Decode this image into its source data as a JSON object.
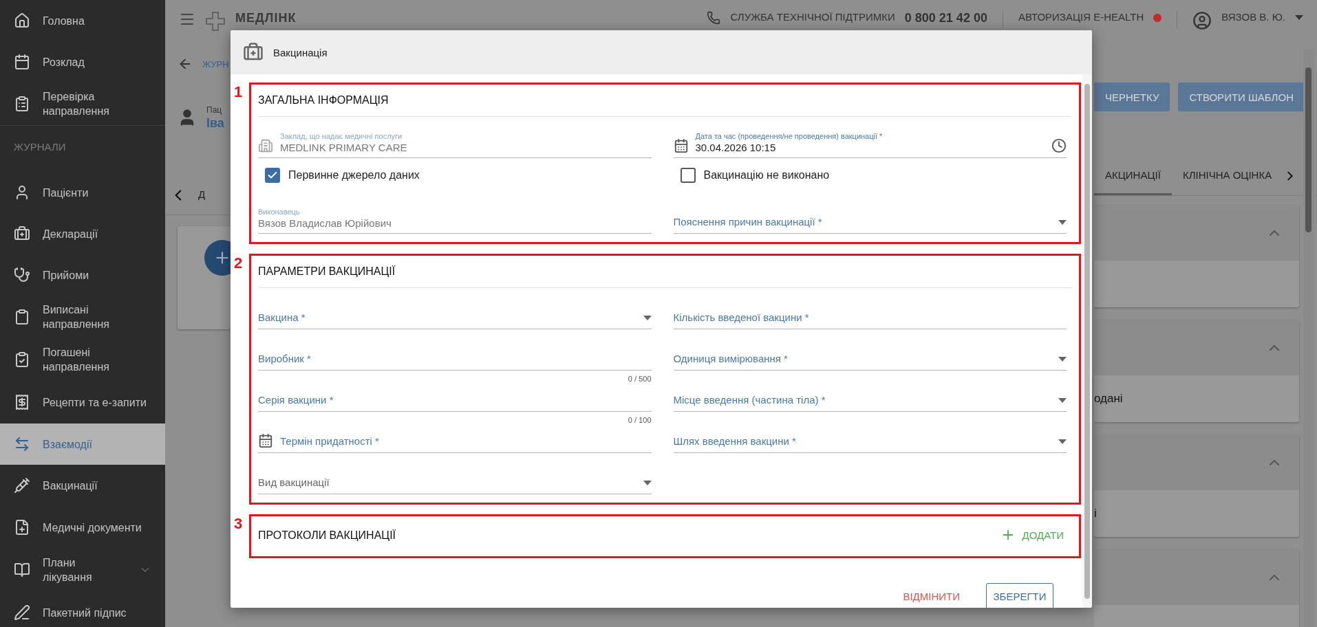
{
  "sidebar": {
    "items": [
      {
        "label": "Головна",
        "selected": false
      },
      {
        "label": "Розклад",
        "selected": false
      },
      {
        "label": "Перевірка направлення",
        "selected": false
      }
    ],
    "section_title": "ЖУРНАЛИ",
    "journal_items": [
      {
        "label": "Пацієнти",
        "selected": false
      },
      {
        "label": "Декларації",
        "selected": false
      },
      {
        "label": "Прийоми",
        "selected": false
      },
      {
        "label": "Виписані направлення",
        "selected": false
      },
      {
        "label": "Погашені направлення",
        "selected": false
      },
      {
        "label": "Рецепти та е-запити",
        "selected": false
      },
      {
        "label": "Взаємодії",
        "selected": true
      },
      {
        "label": "Вакцинації",
        "selected": false
      },
      {
        "label": "Медичні документи",
        "selected": false
      },
      {
        "label": "Плани лікування",
        "selected": false,
        "expanded": false
      },
      {
        "label": "Пакетний підпис",
        "selected": false
      }
    ]
  },
  "top_bar": {
    "logo": "МЕДЛІНК",
    "support_label": "СЛУЖБА ТЕХНІЧНОЇ ПІДТРИМКИ",
    "support_phone": "0 800 21 42 00",
    "ehealth": "АВТОРИЗАЦІЯ E-HEALTH",
    "ehealth_connected": false,
    "user": "ВЯЗОВ В. Ю."
  },
  "background": {
    "back_link": "ЖУРН",
    "patient_label": "Пац",
    "patient_name": "Іва",
    "tab_fragment": "Д",
    "buttons": [
      "ЧЕРНЕТКУ",
      "СТВОРИТИ ШАБЛОН"
    ],
    "tabs": [
      {
        "label": "АКЦИНАЦІЇ",
        "selected": true
      },
      {
        "label": "КЛІНІЧНА ОЦІНКА",
        "selected": false
      }
    ],
    "cards": [
      {
        "expanded": true
      },
      {
        "expanded": true,
        "text": "одані"
      },
      {
        "expanded": true,
        "text": "і"
      },
      {
        "expanded": true
      }
    ]
  },
  "dialog": {
    "title": "Вакцинація",
    "sections": [
      {
        "number": "1",
        "title": "ЗАГАЛЬНА ІНФОРМАЦІЯ",
        "fields": [
          {
            "kind": "facility",
            "label": "Заклад, що надає медичні послуги",
            "value": "MEDLINK PRIMARY CARE"
          },
          {
            "kind": "datetime",
            "label": "Дата та час (проведення/не проведення) вакцинації *",
            "value": "30.04.2026 10:15"
          },
          {
            "kind": "checkbox",
            "label": "Первинне джерело даних",
            "checked": true
          },
          {
            "kind": "checkbox",
            "label": "Вакцинацію не виконано",
            "checked": false
          },
          {
            "kind": "readonly",
            "label": "Виконавець",
            "value": "Вязов Владислав Юрійович"
          },
          {
            "kind": "select",
            "label": "Пояснення причин вакцинації *",
            "required": true
          }
        ]
      },
      {
        "number": "2",
        "title": "ПАРАМЕТРИ ВАКЦИНАЦІЇ",
        "fields": [
          {
            "kind": "select",
            "label": "Вакцина *",
            "required": true
          },
          {
            "kind": "text",
            "label": "Кількість введеної вакцини *",
            "required": true
          },
          {
            "kind": "text",
            "label": "Виробник *",
            "required": true,
            "counter": "0 / 500"
          },
          {
            "kind": "select",
            "label": "Одиниця вимірювання *",
            "required": true
          },
          {
            "kind": "text",
            "label": "Серія вакцини *",
            "required": true,
            "counter": "0 / 100"
          },
          {
            "kind": "select",
            "label": "Місце введення (частина тіла) *",
            "required": true
          },
          {
            "kind": "date",
            "label": "Термін придатності *",
            "required": true
          },
          {
            "kind": "select",
            "label": "Шлях введення вакцини *",
            "required": true
          },
          {
            "kind": "select",
            "label": "Вид вакцинації",
            "required": false
          }
        ]
      },
      {
        "number": "3",
        "title": "ПРОТОКОЛИ ВАКЦИНАЦІЇ",
        "add_button": "ДОДАТИ"
      }
    ],
    "cancel_button": "ВІДМІНИТИ",
    "save_button": "ЗБЕРЕГТИ"
  }
}
